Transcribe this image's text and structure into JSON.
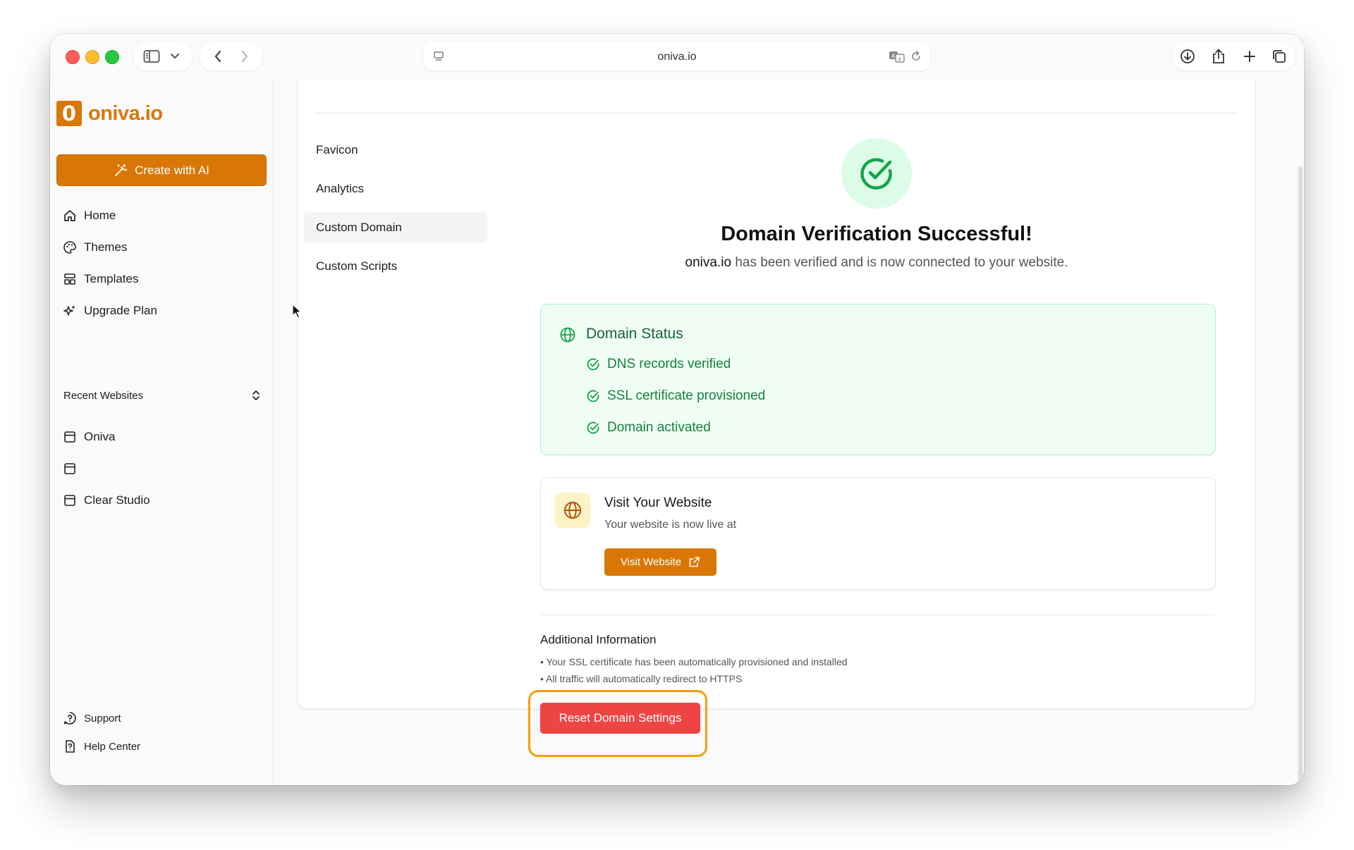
{
  "browser": {
    "url": "oniva.io"
  },
  "sidebar": {
    "logo_mark": "0",
    "logo_text": "oniva.io",
    "create_button": "Create with AI",
    "nav": [
      {
        "label": "Home",
        "icon": "home-icon"
      },
      {
        "label": "Themes",
        "icon": "palette-icon"
      },
      {
        "label": "Templates",
        "icon": "layout-grid-icon"
      },
      {
        "label": "Upgrade Plan",
        "icon": "sparkles-icon"
      }
    ],
    "recent_heading": "Recent Websites",
    "recent": [
      {
        "label": "Oniva"
      },
      {
        "label": ""
      },
      {
        "label": "Clear Studio"
      }
    ],
    "footer": [
      {
        "label": "Support",
        "icon": "help-circle-icon"
      },
      {
        "label": "Help Center",
        "icon": "help-file-icon"
      }
    ]
  },
  "settings_nav": [
    {
      "label": "Favicon",
      "active": false
    },
    {
      "label": "Analytics",
      "active": false
    },
    {
      "label": "Custom Domain",
      "active": true
    },
    {
      "label": "Custom Scripts",
      "active": false
    }
  ],
  "verification": {
    "title": "Domain Verification Successful!",
    "domain": "oniva.io",
    "subtitle_rest": " has been verified and is now connected to your website."
  },
  "domain_status": {
    "title": "Domain Status",
    "items": [
      "DNS records verified",
      "SSL certificate provisioned",
      "Domain activated"
    ]
  },
  "visit": {
    "title": "Visit Your Website",
    "subtitle": "Your website is now live at",
    "button": "Visit Website"
  },
  "additional_info": {
    "title": "Additional Information",
    "lines": [
      "• Your SSL certificate has been automatically provisioned and installed",
      "• All traffic will automatically redirect to HTTPS"
    ]
  },
  "reset_button": "Reset Domain Settings",
  "colors": {
    "brand": "#d97706",
    "success": "#15803d",
    "danger": "#ef4444",
    "focus_ring": "#f59e0b"
  }
}
